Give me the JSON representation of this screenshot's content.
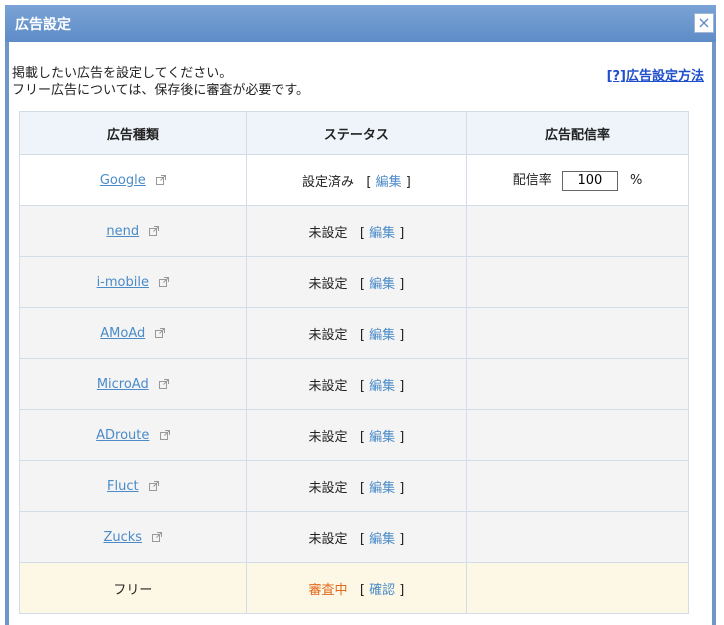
{
  "dialog": {
    "title": "広告設定",
    "close_label": "×"
  },
  "intro": {
    "line1": "掲載したい広告を設定してください。",
    "line2": "フリー広告については、保存後に審査が必要です。",
    "help_link": "[?]広告設定方法"
  },
  "table": {
    "headers": [
      "広告種類",
      "ステータス",
      "広告配信率"
    ],
    "rows": [
      {
        "name": "Google",
        "status": "設定済み",
        "action": "編集",
        "rate_label": "配信率",
        "rate_value": "100",
        "rate_unit": "%"
      },
      {
        "name": "nend",
        "status": "未設定",
        "action": "編集"
      },
      {
        "name": "i-mobile",
        "status": "未設定",
        "action": "編集"
      },
      {
        "name": "AMoAd",
        "status": "未設定",
        "action": "編集"
      },
      {
        "name": "MicroAd",
        "status": "未設定",
        "action": "編集"
      },
      {
        "name": "ADroute",
        "status": "未設定",
        "action": "編集"
      },
      {
        "name": "Fluct",
        "status": "未設定",
        "action": "編集"
      },
      {
        "name": "Zucks",
        "status": "未設定",
        "action": "編集"
      },
      {
        "name": "フリー",
        "status": "審査中",
        "action": "確認"
      }
    ]
  },
  "colors": {
    "titlebar": "#6f98c8",
    "link": "#4a8bc8",
    "reviewing": "#e06a1c",
    "header_bg": "#eef4fa"
  }
}
